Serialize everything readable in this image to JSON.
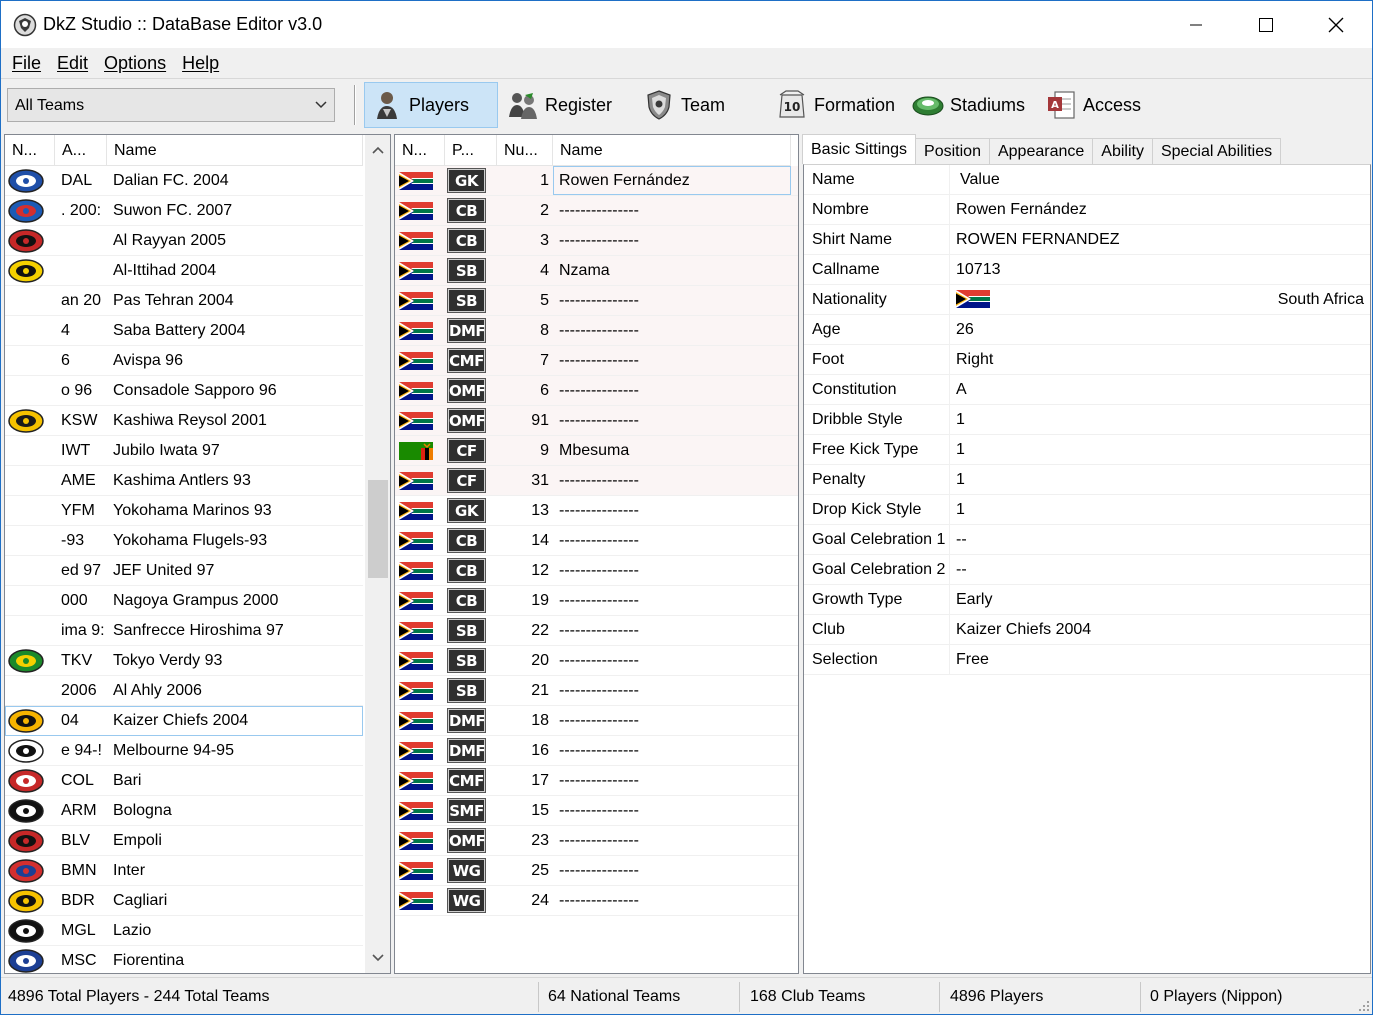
{
  "window": {
    "title": "DkZ Studio :: DataBase Editor v3.0"
  },
  "menu": {
    "items": [
      "File",
      "Edit",
      "Options",
      "Help"
    ]
  },
  "toolbar": {
    "team_filter": "All Teams",
    "buttons": [
      "Players",
      "Register",
      "Team",
      "Formation",
      "Stadiums",
      "Access"
    ],
    "active": "Players"
  },
  "teams_list": {
    "columns": [
      "N...",
      "A...",
      "Name"
    ],
    "rows": [
      {
        "abbr": "DAL",
        "name": "Dalian FC. 2004",
        "crest": "dalian-crest"
      },
      {
        "abbr": ". 200:",
        "name": "Suwon FC. 2007",
        "crest": "suwon-crest"
      },
      {
        "abbr": "",
        "name": "Al Rayyan 2005",
        "crest": "al-rayyan-crest"
      },
      {
        "abbr": "",
        "name": "Al-Ittihad 2004",
        "crest": "al-ittihad-crest"
      },
      {
        "abbr": "an 20",
        "name": "Pas Tehran 2004",
        "crest": ""
      },
      {
        "abbr": "4",
        "name": "Saba Battery 2004",
        "crest": ""
      },
      {
        "abbr": "6",
        "name": "Avispa 96",
        "crest": ""
      },
      {
        "abbr": "o 96",
        "name": "Consadole Sapporo 96",
        "crest": ""
      },
      {
        "abbr": "KSW",
        "name": "Kashiwa Reysol 2001",
        "crest": "kashiwa-crest"
      },
      {
        "abbr": "IWT",
        "name": "Jubilo Iwata 97",
        "crest": ""
      },
      {
        "abbr": "AME",
        "name": "Kashima Antlers 93",
        "crest": ""
      },
      {
        "abbr": "YFM",
        "name": "Yokohama Marinos 93",
        "crest": ""
      },
      {
        "abbr": "-93",
        "name": "Yokohama Flugels-93",
        "crest": ""
      },
      {
        "abbr": "ed 97",
        "name": "JEF United 97",
        "crest": ""
      },
      {
        "abbr": "000",
        "name": "Nagoya Grampus 2000",
        "crest": ""
      },
      {
        "abbr": "ima 9:",
        "name": "Sanfrecce Hiroshima 97",
        "crest": ""
      },
      {
        "abbr": "TKV",
        "name": "Tokyo Verdy 93",
        "crest": "verdy-crest"
      },
      {
        "abbr": "2006",
        "name": "Al Ahly 2006",
        "crest": ""
      },
      {
        "abbr": "04",
        "name": "Kaizer Chiefs 2004",
        "crest": "kaizer-crest"
      },
      {
        "abbr": "e 94-!",
        "name": "Melbourne 94-95",
        "crest": "melbourne-crest"
      },
      {
        "abbr": "COL",
        "name": "Bari",
        "crest": "bari-crest"
      },
      {
        "abbr": "ARM",
        "name": "Bologna",
        "crest": "bologna-crest"
      },
      {
        "abbr": "BLV",
        "name": "Empoli",
        "crest": "empoli-crest"
      },
      {
        "abbr": "BMN",
        "name": "Inter",
        "crest": "inter-crest"
      },
      {
        "abbr": "BDR",
        "name": "Cagliari",
        "crest": "cagliari-crest"
      },
      {
        "abbr": "MGL",
        "name": "Lazio",
        "crest": "lazio-crest"
      },
      {
        "abbr": "MSC",
        "name": "Fiorentina",
        "crest": "fiorentina-crest"
      }
    ],
    "selected_index": 18
  },
  "players_list": {
    "columns": [
      "N...",
      "P...",
      "Nu...",
      "Name"
    ],
    "rows": [
      {
        "flag": "south-africa",
        "pos": "GK",
        "num": "1",
        "name": "Rowen Fernández"
      },
      {
        "flag": "south-africa",
        "pos": "CB",
        "num": "2",
        "name": "---------------"
      },
      {
        "flag": "south-africa",
        "pos": "CB",
        "num": "3",
        "name": "---------------"
      },
      {
        "flag": "south-africa",
        "pos": "SB",
        "num": "4",
        "name": "Nzama"
      },
      {
        "flag": "south-africa",
        "pos": "SB",
        "num": "5",
        "name": "---------------"
      },
      {
        "flag": "south-africa",
        "pos": "DMF",
        "num": "8",
        "name": "---------------"
      },
      {
        "flag": "south-africa",
        "pos": "CMF",
        "num": "7",
        "name": "---------------"
      },
      {
        "flag": "south-africa",
        "pos": "OMF",
        "num": "6",
        "name": "---------------"
      },
      {
        "flag": "south-africa",
        "pos": "OMF",
        "num": "91",
        "name": "---------------"
      },
      {
        "flag": "zambia",
        "pos": "CF",
        "num": "9",
        "name": "Mbesuma"
      },
      {
        "flag": "south-africa",
        "pos": "CF",
        "num": "31",
        "name": "---------------"
      },
      {
        "flag": "south-africa",
        "pos": "GK",
        "num": "13",
        "name": "---------------"
      },
      {
        "flag": "south-africa",
        "pos": "CB",
        "num": "14",
        "name": "---------------"
      },
      {
        "flag": "south-africa",
        "pos": "CB",
        "num": "12",
        "name": "---------------"
      },
      {
        "flag": "south-africa",
        "pos": "CB",
        "num": "19",
        "name": "---------------"
      },
      {
        "flag": "south-africa",
        "pos": "SB",
        "num": "22",
        "name": "---------------"
      },
      {
        "flag": "south-africa",
        "pos": "SB",
        "num": "20",
        "name": "---------------"
      },
      {
        "flag": "south-africa",
        "pos": "SB",
        "num": "21",
        "name": "---------------"
      },
      {
        "flag": "south-africa",
        "pos": "DMF",
        "num": "18",
        "name": "---------------"
      },
      {
        "flag": "south-africa",
        "pos": "DMF",
        "num": "16",
        "name": "---------------"
      },
      {
        "flag": "south-africa",
        "pos": "CMF",
        "num": "17",
        "name": "---------------"
      },
      {
        "flag": "south-africa",
        "pos": "SMF",
        "num": "15",
        "name": "---------------"
      },
      {
        "flag": "south-africa",
        "pos": "OMF",
        "num": "23",
        "name": "---------------"
      },
      {
        "flag": "south-africa",
        "pos": "WG",
        "num": "25",
        "name": "---------------"
      },
      {
        "flag": "south-africa",
        "pos": "WG",
        "num": "24",
        "name": "---------------"
      }
    ],
    "selected_index": 0
  },
  "detail": {
    "tabs": [
      "Basic Sittings",
      "Position",
      "Appearance",
      "Ability",
      "Special Abilities"
    ],
    "active_tab": "Basic Sittings",
    "header": {
      "key": "Name",
      "value": "Value"
    },
    "rows": [
      {
        "key": "Nombre",
        "value": "Rowen Fernández"
      },
      {
        "key": "Shirt Name",
        "value": "ROWEN FERNANDEZ"
      },
      {
        "key": "Callname",
        "value": "10713"
      },
      {
        "key": "Nationality",
        "value": "South Africa",
        "flag": "south-africa"
      },
      {
        "key": "Age",
        "value": "26"
      },
      {
        "key": "Foot",
        "value": "Right"
      },
      {
        "key": "Constitution",
        "value": "A"
      },
      {
        "key": "Dribble Style",
        "value": "1"
      },
      {
        "key": "Free Kick Type",
        "value": "1"
      },
      {
        "key": "Penalty",
        "value": "1"
      },
      {
        "key": "Drop Kick Style",
        "value": "1"
      },
      {
        "key": "Goal Celebration 1",
        "value": "--"
      },
      {
        "key": "Goal Celebration 2",
        "value": "--"
      },
      {
        "key": "Growth Type",
        "value": "Early"
      },
      {
        "key": "Club",
        "value": "Kaizer Chiefs 2004"
      },
      {
        "key": "Selection",
        "value": "Free"
      }
    ]
  },
  "status": {
    "total": "4896 Total Players  -  244 Total Teams",
    "national": "64 National Teams",
    "club": "168 Club Teams",
    "players": "4896 Players",
    "nippon": "0 Players (Nippon)"
  },
  "colors": {
    "accent": "#1e6fc6",
    "selection_bg": "#cce4f7",
    "selection_border": "#99c9ef",
    "badge_bg": "#2f2f2f"
  }
}
